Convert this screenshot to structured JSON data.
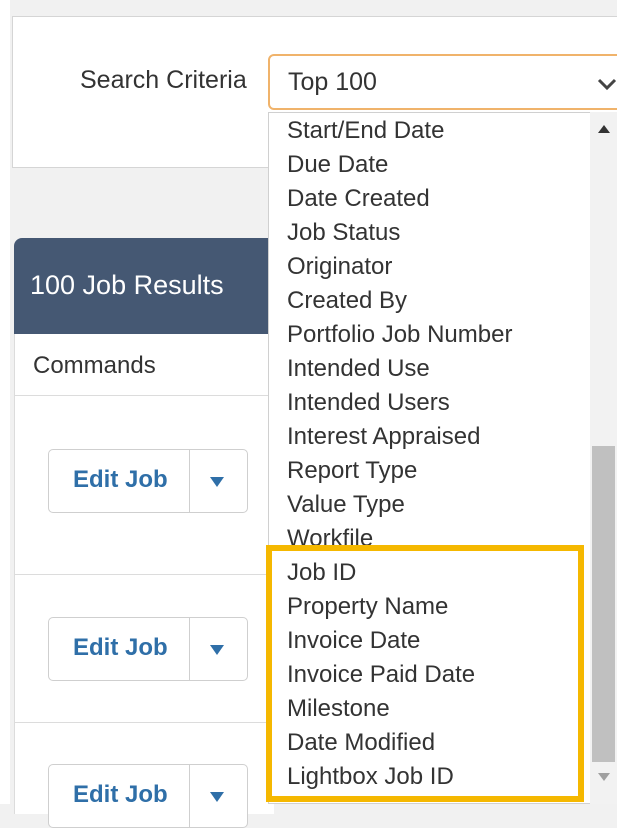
{
  "search": {
    "label": "Search Criteria",
    "selected": "Top 100",
    "options": [
      "Start/End Date",
      "Due Date",
      "Date Created",
      "Job Status",
      "Originator",
      "Created By",
      "Portfolio Job Number",
      "Intended Use",
      "Intended Users",
      "Interest Appraised",
      "Report Type",
      "Value Type",
      "Workfile",
      "Job ID",
      "Property Name",
      "Invoice Date",
      "Invoice Paid Date",
      "Milestone",
      "Date Modified",
      "Lightbox Job ID"
    ]
  },
  "results": {
    "title": "100 Job Results",
    "commands_header": "Commands",
    "rows": [
      {
        "edit_label": "Edit Job"
      },
      {
        "edit_label": "Edit Job"
      },
      {
        "edit_label": "Edit Job"
      }
    ]
  },
  "colors": {
    "header_bg": "#455873",
    "link_blue": "#2f6fa8",
    "select_border": "#f0b36b",
    "highlight": "#f5b800"
  },
  "icons": {
    "select_chevron": "chevron-down-icon",
    "edit_caret": "caret-down-icon",
    "scroll_up": "scroll-up-icon",
    "scroll_down": "scroll-down-icon"
  }
}
